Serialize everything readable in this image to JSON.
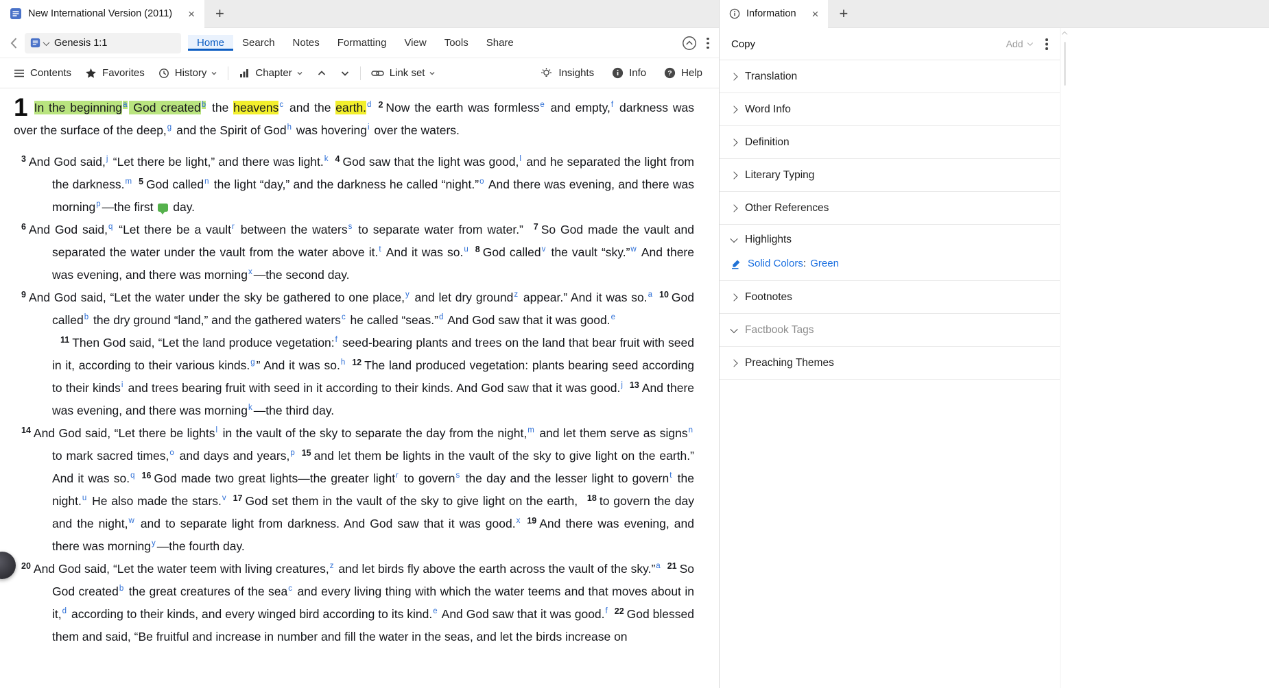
{
  "colors": {
    "accent_blue": "#0b5cc2",
    "footnote_blue": "#2e6fd6",
    "link_blue": "#1a6fe0",
    "highlight_green": "#b9e47f",
    "highlight_yellow": "#f2ef2d",
    "note_green": "#55b14c"
  },
  "left_panel": {
    "tab": {
      "title": "New International Version (2011)",
      "close": "×",
      "add": "+"
    },
    "toolbar": {
      "reference": "Genesis 1:1",
      "menu": [
        {
          "label": "Home",
          "active": true
        },
        {
          "label": "Search"
        },
        {
          "label": "Notes"
        },
        {
          "label": "Formatting"
        },
        {
          "label": "View"
        },
        {
          "label": "Tools"
        },
        {
          "label": "Share"
        }
      ]
    },
    "toolbar2": {
      "left": [
        {
          "name": "contents-button",
          "icon": "menu-icon",
          "label": "Contents"
        },
        {
          "name": "favorites-button",
          "icon": "star-icon",
          "label": "Favorites"
        },
        {
          "name": "history-button",
          "icon": "history-icon",
          "label": "History",
          "dropdown": true
        },
        {
          "divider": true
        },
        {
          "name": "chapter-button",
          "icon": "chapter-icon",
          "label": "Chapter",
          "dropdown": true
        },
        {
          "name": "previous-chapter-button",
          "icon": "chevron-up-icon"
        },
        {
          "name": "next-chapter-button",
          "icon": "chevron-down-icon"
        },
        {
          "divider": true
        },
        {
          "name": "link-set-button",
          "icon": "link-icon",
          "label": "Link set",
          "dropdown": true
        }
      ],
      "right": [
        {
          "name": "insights-button",
          "icon": "insights-icon",
          "label": "Insights"
        },
        {
          "name": "info-button",
          "icon": "info-icon",
          "label": "Info"
        },
        {
          "name": "help-button",
          "icon": "help-icon",
          "label": "Help"
        }
      ]
    },
    "bible": {
      "chapter": "1",
      "paragraphs": [
        {
          "cls": "first",
          "runs": [
            {
              "k": "gt",
              "x": "In the beginning"
            },
            {
              "k": "gf",
              "x": "a"
            },
            {
              "k": "gt",
              "x": " God created"
            },
            {
              "k": "gf",
              "x": "b"
            },
            {
              "k": "t",
              "x": " the "
            },
            {
              "k": "yt",
              "x": "heavens"
            },
            {
              "k": "f",
              "x": "c"
            },
            {
              "k": "t",
              "x": " and the "
            },
            {
              "k": "yt",
              "x": "earth."
            },
            {
              "k": "f",
              "x": "d"
            },
            {
              "k": "v",
              "x": "2"
            },
            {
              "k": "t",
              "x": "Now the earth was formless"
            },
            {
              "k": "f",
              "x": "e"
            },
            {
              "k": "t",
              "x": " and empty,"
            },
            {
              "k": "f",
              "x": "f"
            },
            {
              "k": "t",
              "x": " darkness was over the surface of the deep,"
            },
            {
              "k": "f",
              "x": "g"
            },
            {
              "k": "t",
              "x": " and the Spirit of God"
            },
            {
              "k": "f",
              "x": "h"
            },
            {
              "k": "t",
              "x": " was hovering"
            },
            {
              "k": "f",
              "x": "i"
            },
            {
              "k": "t",
              "x": " over the waters."
            }
          ]
        },
        {
          "cls": "hang",
          "runs": [
            {
              "k": "v",
              "x": "3"
            },
            {
              "k": "t",
              "x": "And God said,"
            },
            {
              "k": "f",
              "x": "j"
            },
            {
              "k": "t",
              "x": " “Let there be light,” and there was light."
            },
            {
              "k": "f",
              "x": "k"
            },
            {
              "k": "v",
              "x": "4"
            },
            {
              "k": "t",
              "x": "God saw that the light was good,"
            },
            {
              "k": "f",
              "x": "l"
            },
            {
              "k": "t",
              "x": " and he separated the light from the darkness."
            },
            {
              "k": "f",
              "x": "m"
            },
            {
              "k": "v",
              "x": "5"
            },
            {
              "k": "t",
              "x": "God called"
            },
            {
              "k": "f",
              "x": "n"
            },
            {
              "k": "t",
              "x": " the light “day,” and the darkness he called “night.”"
            },
            {
              "k": "f",
              "x": "o"
            },
            {
              "k": "t",
              "x": " And there was evening, and there was morning"
            },
            {
              "k": "f",
              "x": "p"
            },
            {
              "k": "t",
              "x": "—the first "
            },
            {
              "k": "note",
              "x": ""
            },
            {
              "k": "t",
              "x": " day."
            }
          ]
        },
        {
          "cls": "hang",
          "runs": [
            {
              "k": "v",
              "x": "6"
            },
            {
              "k": "t",
              "x": "And God said,"
            },
            {
              "k": "f",
              "x": "q"
            },
            {
              "k": "t",
              "x": " “Let there be a vault"
            },
            {
              "k": "f",
              "x": "r"
            },
            {
              "k": "t",
              "x": " between the waters"
            },
            {
              "k": "f",
              "x": "s"
            },
            {
              "k": "t",
              "x": " to separate water from water.” "
            },
            {
              "k": "v",
              "x": "7"
            },
            {
              "k": "t",
              "x": "So God made the vault and separated the water under the vault from the water above it."
            },
            {
              "k": "f",
              "x": "t"
            },
            {
              "k": "t",
              "x": " And it was so."
            },
            {
              "k": "f",
              "x": "u"
            },
            {
              "k": "v",
              "x": "8"
            },
            {
              "k": "t",
              "x": "God called"
            },
            {
              "k": "f",
              "x": "v"
            },
            {
              "k": "t",
              "x": " the vault “sky.”"
            },
            {
              "k": "f",
              "x": "w"
            },
            {
              "k": "t",
              "x": " And there was evening, and there was morning"
            },
            {
              "k": "f",
              "x": "x"
            },
            {
              "k": "t",
              "x": "—the second day."
            }
          ]
        },
        {
          "cls": "hang",
          "runs": [
            {
              "k": "v",
              "x": "9"
            },
            {
              "k": "t",
              "x": "And God said, “Let the water under the sky be gathered to one place,"
            },
            {
              "k": "f",
              "x": "y"
            },
            {
              "k": "t",
              "x": " and let dry ground"
            },
            {
              "k": "f",
              "x": "z"
            },
            {
              "k": "t",
              "x": " appear.” And it was so."
            },
            {
              "k": "f",
              "x": "a"
            },
            {
              "k": "v",
              "x": "10"
            },
            {
              "k": "t",
              "x": "God called"
            },
            {
              "k": "f",
              "x": "b"
            },
            {
              "k": "t",
              "x": " the dry ground “land,” and the gathered waters"
            },
            {
              "k": "f",
              "x": "c"
            },
            {
              "k": "t",
              "x": " he called “seas.”"
            },
            {
              "k": "f",
              "x": "d"
            },
            {
              "k": "t",
              "x": " And God saw that it was good."
            },
            {
              "k": "f",
              "x": "e"
            }
          ]
        },
        {
          "cls": "hang pfirst",
          "runs": [
            {
              "k": "v",
              "x": "11"
            },
            {
              "k": "t",
              "x": "Then God said, “Let the land produce vegetation:"
            },
            {
              "k": "f",
              "x": "f"
            },
            {
              "k": "t",
              "x": " seed-bearing plants and trees on the land that bear fruit with seed in it, according to their various kinds."
            },
            {
              "k": "f",
              "x": "g"
            },
            {
              "k": "t",
              "x": "” And it was so."
            },
            {
              "k": "f",
              "x": "h"
            },
            {
              "k": "v",
              "x": "12"
            },
            {
              "k": "t",
              "x": "The land produced vegetation: plants bearing seed according to their kinds"
            },
            {
              "k": "f",
              "x": "i"
            },
            {
              "k": "t",
              "x": " and trees bearing fruit with seed in it according to their kinds. And God saw that it was good."
            },
            {
              "k": "f",
              "x": "j"
            },
            {
              "k": "v",
              "x": "13"
            },
            {
              "k": "t",
              "x": "And there was evening, and there was morning"
            },
            {
              "k": "f",
              "x": "k"
            },
            {
              "k": "t",
              "x": "—the third day."
            }
          ]
        },
        {
          "cls": "hang",
          "runs": [
            {
              "k": "v",
              "x": "14"
            },
            {
              "k": "t",
              "x": "And God said, “Let there be lights"
            },
            {
              "k": "f",
              "x": "l"
            },
            {
              "k": "t",
              "x": " in the vault of the sky to separate the day from the night,"
            },
            {
              "k": "f",
              "x": "m"
            },
            {
              "k": "t",
              "x": " and let them serve as signs"
            },
            {
              "k": "f",
              "x": "n"
            },
            {
              "k": "t",
              "x": " to mark sacred times,"
            },
            {
              "k": "f",
              "x": "o"
            },
            {
              "k": "t",
              "x": " and days and years,"
            },
            {
              "k": "f",
              "x": "p"
            },
            {
              "k": "v",
              "x": "15"
            },
            {
              "k": "t",
              "x": "and let them be lights in the vault of the sky to give light on the earth.” And it was so."
            },
            {
              "k": "f",
              "x": "q"
            },
            {
              "k": "v",
              "x": "16"
            },
            {
              "k": "t",
              "x": "God made two great lights—the greater light"
            },
            {
              "k": "f",
              "x": "r"
            },
            {
              "k": "t",
              "x": " to govern"
            },
            {
              "k": "f",
              "x": "s"
            },
            {
              "k": "t",
              "x": " the day and the lesser light to govern"
            },
            {
              "k": "f",
              "x": "t"
            },
            {
              "k": "t",
              "x": " the night."
            },
            {
              "k": "f",
              "x": "u"
            },
            {
              "k": "t",
              "x": " He also made the stars."
            },
            {
              "k": "f",
              "x": "v"
            },
            {
              "k": "v",
              "x": "17"
            },
            {
              "k": "t",
              "x": "God set them in the vault of the sky to give light on the earth, "
            },
            {
              "k": "v",
              "x": "18"
            },
            {
              "k": "t",
              "x": "to govern the day and the night,"
            },
            {
              "k": "f",
              "x": "w"
            },
            {
              "k": "t",
              "x": " and to separate light from darkness. And God saw that it was good."
            },
            {
              "k": "f",
              "x": "x"
            },
            {
              "k": "v",
              "x": "19"
            },
            {
              "k": "t",
              "x": "And there was evening, and there was morning"
            },
            {
              "k": "f",
              "x": "y"
            },
            {
              "k": "t",
              "x": "—the fourth day."
            }
          ]
        },
        {
          "cls": "hang",
          "runs": [
            {
              "k": "v",
              "x": "20"
            },
            {
              "k": "t",
              "x": "And God said, “Let the water teem with living creatures,"
            },
            {
              "k": "f",
              "x": "z"
            },
            {
              "k": "t",
              "x": " and let birds fly above the earth across the vault of the sky.”"
            },
            {
              "k": "f",
              "x": "a"
            },
            {
              "k": "v",
              "x": "21"
            },
            {
              "k": "t",
              "x": "So God created"
            },
            {
              "k": "f",
              "x": "b"
            },
            {
              "k": "t",
              "x": " the great creatures of the sea"
            },
            {
              "k": "f",
              "x": "c"
            },
            {
              "k": "t",
              "x": " and every living thing with which the water teems and that moves about in it,"
            },
            {
              "k": "f",
              "x": "d"
            },
            {
              "k": "t",
              "x": " according to their kinds, and every winged bird according to its kind."
            },
            {
              "k": "f",
              "x": "e"
            },
            {
              "k": "t",
              "x": " And God saw that it was good."
            },
            {
              "k": "f",
              "x": "f"
            },
            {
              "k": "v",
              "x": "22"
            },
            {
              "k": "t",
              "x": "God blessed them and said, “Be fruitful and increase in number and fill the water in the seas, and let the birds increase on"
            }
          ]
        }
      ]
    }
  },
  "info_panel": {
    "tab_title": "Information",
    "tab_close": "×",
    "tab_add": "+",
    "copy_label": "Copy",
    "add_label": "Add",
    "sections": [
      {
        "label": "Translation",
        "expanded": false
      },
      {
        "label": "Word Info",
        "expanded": false
      },
      {
        "label": "Definition",
        "expanded": false
      },
      {
        "label": "Literary Typing",
        "expanded": false
      },
      {
        "label": "Other References",
        "expanded": false
      },
      {
        "label": "Highlights",
        "expanded": true,
        "content": {
          "type": "highlight",
          "link1": "Solid Colors",
          "sep": ":",
          "link2": "Green"
        }
      },
      {
        "label": "Footnotes",
        "expanded": false
      },
      {
        "label": "Factbook Tags",
        "expanded": true,
        "muted": true
      },
      {
        "label": "Preaching Themes",
        "expanded": false
      }
    ]
  }
}
